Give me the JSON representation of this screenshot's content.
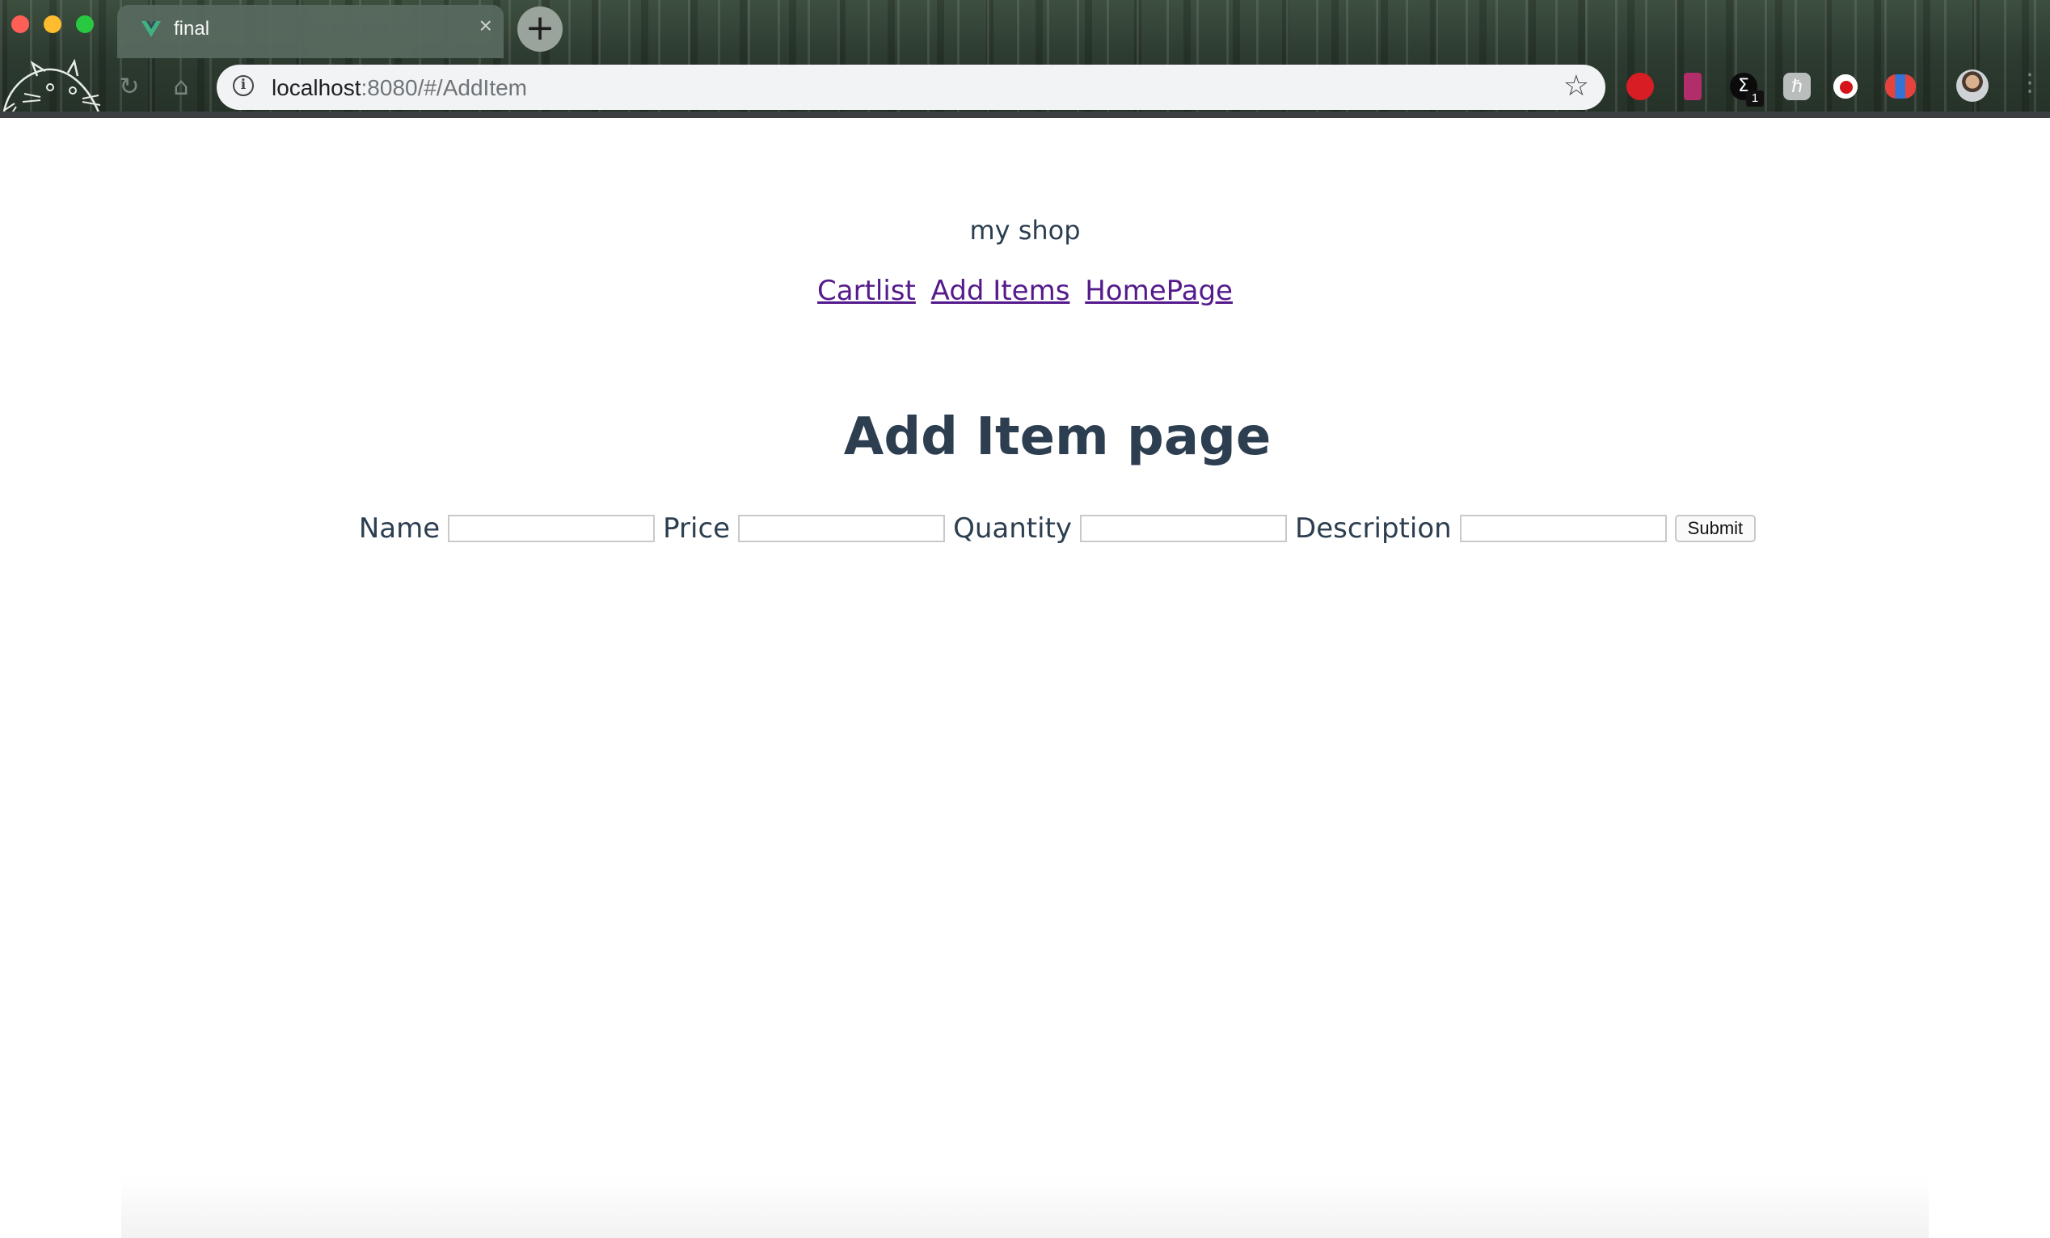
{
  "browser": {
    "tab": {
      "title": "final"
    },
    "new_tab_glyph": "+",
    "close_glyph": "×",
    "url": {
      "host": "localhost",
      "rest": ":8080/#/AddItem"
    },
    "info_glyph": "i",
    "star_glyph": "☆",
    "reload_glyph": "↻",
    "home_glyph": "⌂",
    "menu_glyph": "⋮",
    "extensions": {
      "sigma_glyph": "Σ",
      "sigma_badge": "1",
      "hk_glyph": "ℏ"
    }
  },
  "page": {
    "shop_title": "my shop",
    "nav": [
      "Cartlist",
      "Add Items",
      "HomePage"
    ],
    "heading": "Add Item page",
    "form": {
      "name_label": "Name",
      "price_label": "Price",
      "quantity_label": "Quantity",
      "description_label": "Description",
      "submit_label": "Submit"
    }
  }
}
